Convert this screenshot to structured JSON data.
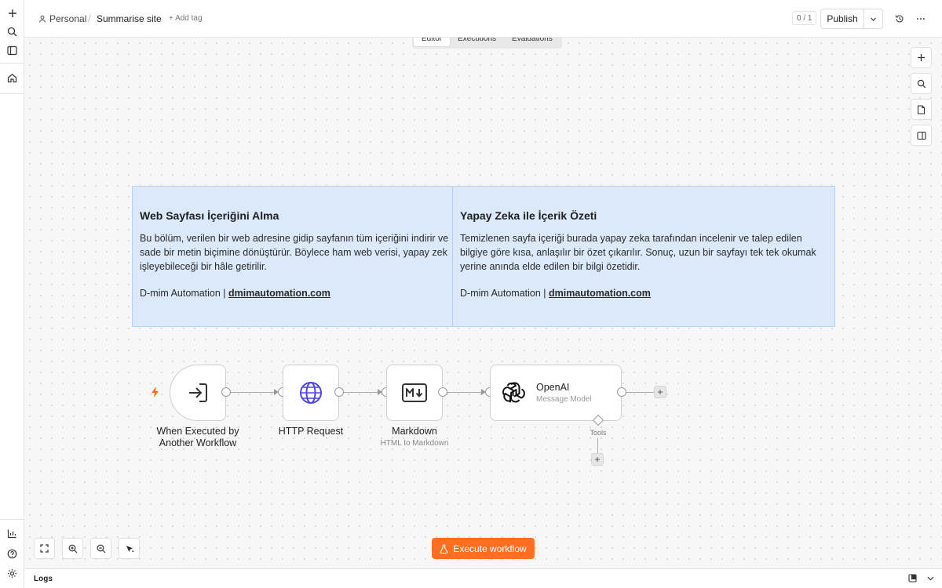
{
  "header": {
    "project": "Personal",
    "workflow_name": "Summarise site",
    "add_tag": "+ Add tag",
    "counter": "0 / 1",
    "publish": "Publish"
  },
  "tabs": [
    {
      "label": "Editor",
      "active": true
    },
    {
      "label": "Executions",
      "active": false
    },
    {
      "label": "Evaluations",
      "active": false
    }
  ],
  "sticky_notes": [
    {
      "title": "Web Sayfası İçeriğini Alma",
      "lines": [
        "Bu bölüm, verilen bir web adresine gidip sayfanın tüm içeriğini indirir ve",
        "sade bir metin biçimine dönüştürür. Böylece ham web verisi, yapay zek",
        "işleyebileceği bir hâle getirilir."
      ],
      "signature_prefix": "D-mim Automation | ",
      "signature_link": "dmimautomation.com"
    },
    {
      "title": "Yapay Zeka ile İçerik Özeti",
      "lines": [
        "Temizlenen sayfa içeriği burada yapay zeka tarafından incelenir ve talep edilen",
        "bilgiye göre kısa, anlaşılır bir özet çıkarılır. Sonuç, uzun bir sayfayı tek tek okumak",
        "yerine anında elde edilen bir bilgi özetidir."
      ],
      "signature_prefix": "D-mim Automation | ",
      "signature_link": "dmimautomation.com"
    }
  ],
  "nodes": [
    {
      "title_line1": "When Executed by",
      "title_line2": "Another Workflow",
      "icon": "sign-in-icon"
    },
    {
      "title": "HTTP Request",
      "icon": "globe-icon"
    },
    {
      "title": "Markdown",
      "subtitle": "HTML to Markdown",
      "icon": "markdown-icon"
    },
    {
      "title": "OpenAI",
      "subtitle": "Message Model",
      "icon": "openai-icon",
      "tools_label": "Tools"
    }
  ],
  "plus_symbol": "+",
  "execute_button": "Execute workflow",
  "logs_label": "Logs",
  "colors": {
    "accent": "#ff6d1f",
    "sticky_bg": "#dbe9fb",
    "sticky_border": "#b9d1f0",
    "globe": "#4f46e5",
    "trigger_bolt": "#ff6d1f"
  }
}
